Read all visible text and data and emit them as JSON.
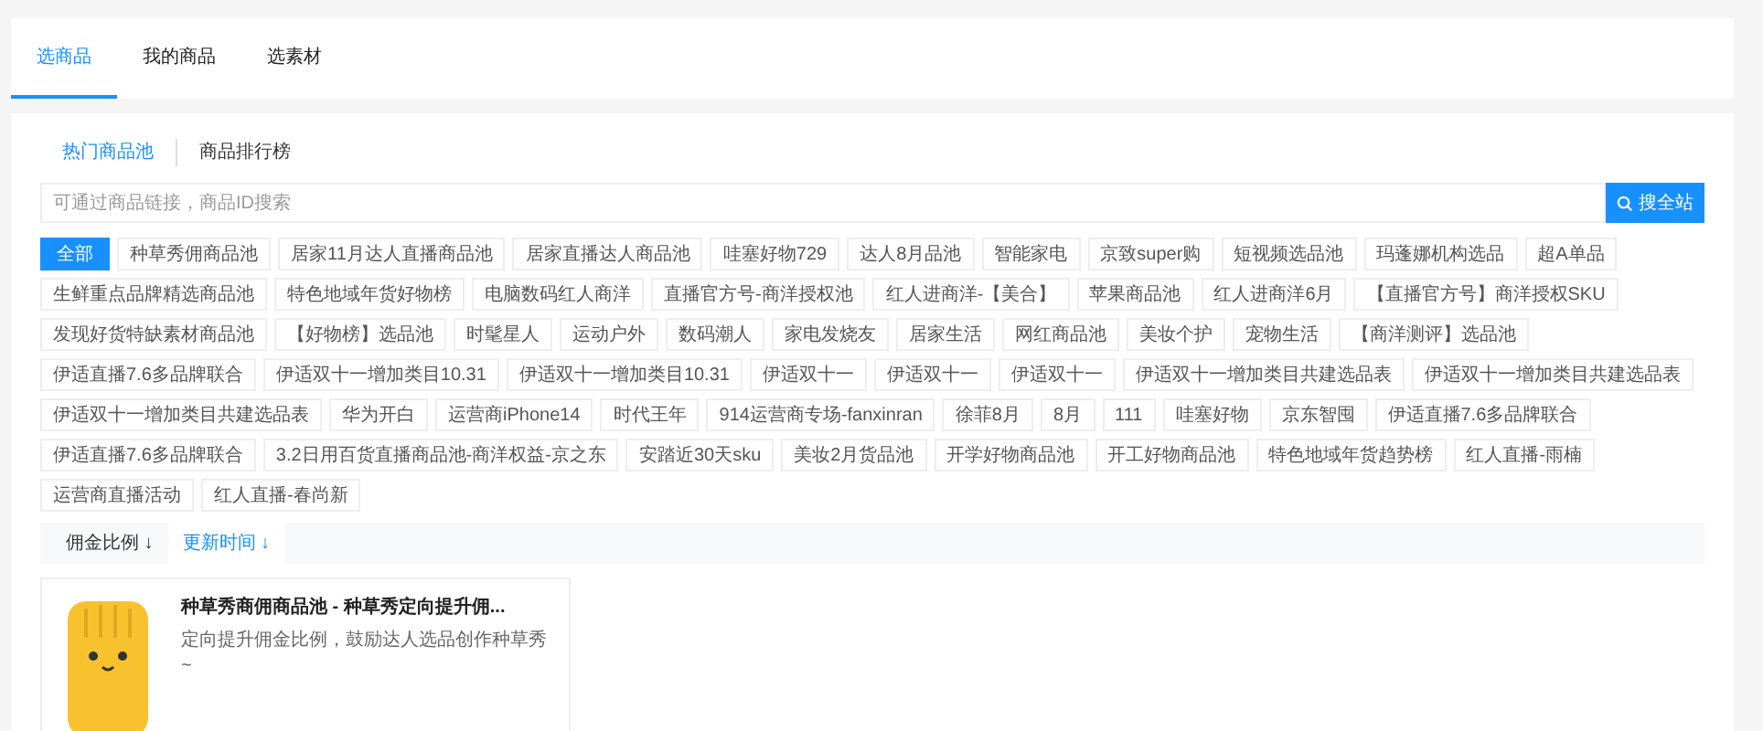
{
  "tabs": [
    {
      "label": "选商品",
      "selected": true
    },
    {
      "label": "我的商品",
      "selected": false
    },
    {
      "label": "选素材",
      "selected": false
    }
  ],
  "sub_tabs": [
    {
      "label": "热门商品池",
      "selected": true
    },
    {
      "label": "商品排行榜",
      "selected": false
    }
  ],
  "search": {
    "placeholder": "可通过商品链接，商品ID搜索",
    "button": "搜全站"
  },
  "tags": [
    {
      "label": "全部",
      "selected": true
    },
    {
      "label": "种草秀佣商品池",
      "selected": false
    },
    {
      "label": "居家11月达人直播商品池",
      "selected": false
    },
    {
      "label": "居家直播达人商品池",
      "selected": false
    },
    {
      "label": "哇塞好物729",
      "selected": false
    },
    {
      "label": "达人8月品池",
      "selected": false
    },
    {
      "label": "智能家电",
      "selected": false
    },
    {
      "label": "京致super购",
      "selected": false
    },
    {
      "label": "短视频选品池",
      "selected": false
    },
    {
      "label": "玛蓬娜机构选品",
      "selected": false
    },
    {
      "label": "超A单品",
      "selected": false
    },
    {
      "label": "生鲜重点品牌精选商品池",
      "selected": false
    },
    {
      "label": "特色地域年货好物榜",
      "selected": false
    },
    {
      "label": "电脑数码红人商洋",
      "selected": false
    },
    {
      "label": "直播官方号-商洋授权池",
      "selected": false
    },
    {
      "label": "红人进商洋-【美合】",
      "selected": false
    },
    {
      "label": "苹果商品池",
      "selected": false
    },
    {
      "label": "红人进商洋6月",
      "selected": false
    },
    {
      "label": "【直播官方号】商洋授权SKU",
      "selected": false
    },
    {
      "label": "发现好货特缺素材商品池",
      "selected": false
    },
    {
      "label": "【好物榜】选品池",
      "selected": false
    },
    {
      "label": "时髦星人",
      "selected": false
    },
    {
      "label": "运动户外",
      "selected": false
    },
    {
      "label": "数码潮人",
      "selected": false
    },
    {
      "label": "家电发烧友",
      "selected": false
    },
    {
      "label": "居家生活",
      "selected": false
    },
    {
      "label": "网红商品池",
      "selected": false
    },
    {
      "label": "美妆个护",
      "selected": false
    },
    {
      "label": "宠物生活",
      "selected": false
    },
    {
      "label": "【商洋测评】选品池",
      "selected": false
    },
    {
      "label": "伊适直播7.6多品牌联合",
      "selected": false
    },
    {
      "label": "伊适双十一增加类目10.31",
      "selected": false
    },
    {
      "label": "伊适双十一增加类目10.31",
      "selected": false
    },
    {
      "label": "伊适双十一",
      "selected": false
    },
    {
      "label": "伊适双十一",
      "selected": false
    },
    {
      "label": "伊适双十一",
      "selected": false
    },
    {
      "label": "伊适双十一增加类目共建选品表",
      "selected": false
    },
    {
      "label": "伊适双十一增加类目共建选品表",
      "selected": false
    },
    {
      "label": "伊适双十一增加类目共建选品表",
      "selected": false
    },
    {
      "label": "华为开白",
      "selected": false
    },
    {
      "label": "运营商iPhone14",
      "selected": false
    },
    {
      "label": "时代王年",
      "selected": false
    },
    {
      "label": "914运营商专场-fanxinran",
      "selected": false
    },
    {
      "label": "徐菲8月",
      "selected": false
    },
    {
      "label": "8月",
      "selected": false
    },
    {
      "label": "111",
      "selected": false
    },
    {
      "label": "哇塞好物",
      "selected": false
    },
    {
      "label": "京东智囤",
      "selected": false
    },
    {
      "label": "伊适直播7.6多品牌联合",
      "selected": false
    },
    {
      "label": "伊适直播7.6多品牌联合",
      "selected": false
    },
    {
      "label": "3.2日用百货直播商品池-商洋权益-京之东",
      "selected": false
    },
    {
      "label": "安踏近30天sku",
      "selected": false
    },
    {
      "label": "美妆2月货品池",
      "selected": false
    },
    {
      "label": "开学好物商品池",
      "selected": false
    },
    {
      "label": "开工好物商品池",
      "selected": false
    },
    {
      "label": "特色地域年货趋势榜",
      "selected": false
    },
    {
      "label": "红人直播-雨楠",
      "selected": false
    },
    {
      "label": "运营商直播活动",
      "selected": false
    },
    {
      "label": "红人直播-春尚新",
      "selected": false
    }
  ],
  "sort": [
    {
      "label": "佣金比例",
      "arrow": "↓",
      "selected": false
    },
    {
      "label": "更新时间",
      "arrow": "↓",
      "selected": true
    }
  ],
  "cards": [
    {
      "title": "种草秀商佣商品池 - 种草秀定向提升佣...",
      "description": "定向提升佣金比例，鼓励达人选品创作种草秀~"
    }
  ]
}
